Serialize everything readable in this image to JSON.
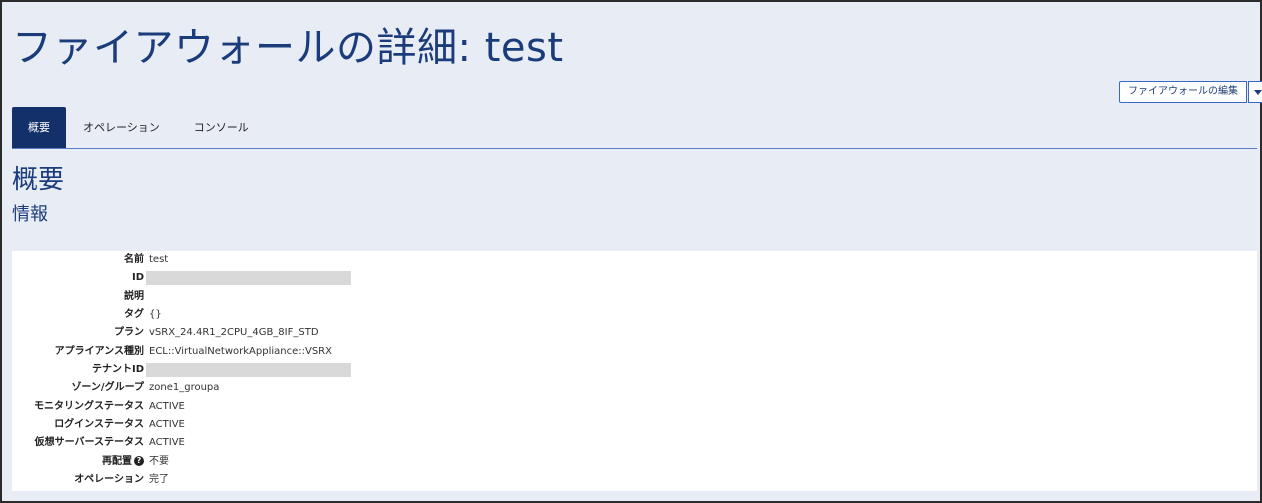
{
  "page": {
    "title": "ファイアウォールの詳細: test"
  },
  "actions": {
    "edit_label": "ファイアウォールの編集",
    "dropdown_icon": "caret-down-icon"
  },
  "tabs": [
    {
      "label": "概要",
      "active": true
    },
    {
      "label": "オペレーション",
      "active": false
    },
    {
      "label": "コンソール",
      "active": false
    }
  ],
  "section": {
    "title": "概要",
    "subtitle": "情報"
  },
  "info": {
    "rows": [
      {
        "label": "名前",
        "value": "test"
      },
      {
        "label": "ID",
        "value": ""
      },
      {
        "label": "説明",
        "value": ""
      },
      {
        "label": "タグ",
        "value": "{}"
      },
      {
        "label": "プラン",
        "value": "vSRX_24.4R1_2CPU_4GB_8IF_STD"
      },
      {
        "label": "アプライアンス種別",
        "value": "ECL::VirtualNetworkAppliance::VSRX"
      },
      {
        "label": "テナントID",
        "value": ""
      },
      {
        "label": "ゾーン/グループ",
        "value": "zone1_groupa"
      },
      {
        "label": "モニタリングステータス",
        "value": "ACTIVE"
      },
      {
        "label": "ログインステータス",
        "value": "ACTIVE"
      },
      {
        "label": "仮想サーバーステータス",
        "value": "ACTIVE"
      },
      {
        "label": "再配置",
        "value": "不要",
        "help_icon": "question-circle-icon"
      },
      {
        "label": "オペレーション",
        "value": "完了"
      }
    ]
  },
  "colors": {
    "background": "#e8ecf5",
    "accent": "#1b3c7a",
    "active_tab": "#13306b"
  }
}
